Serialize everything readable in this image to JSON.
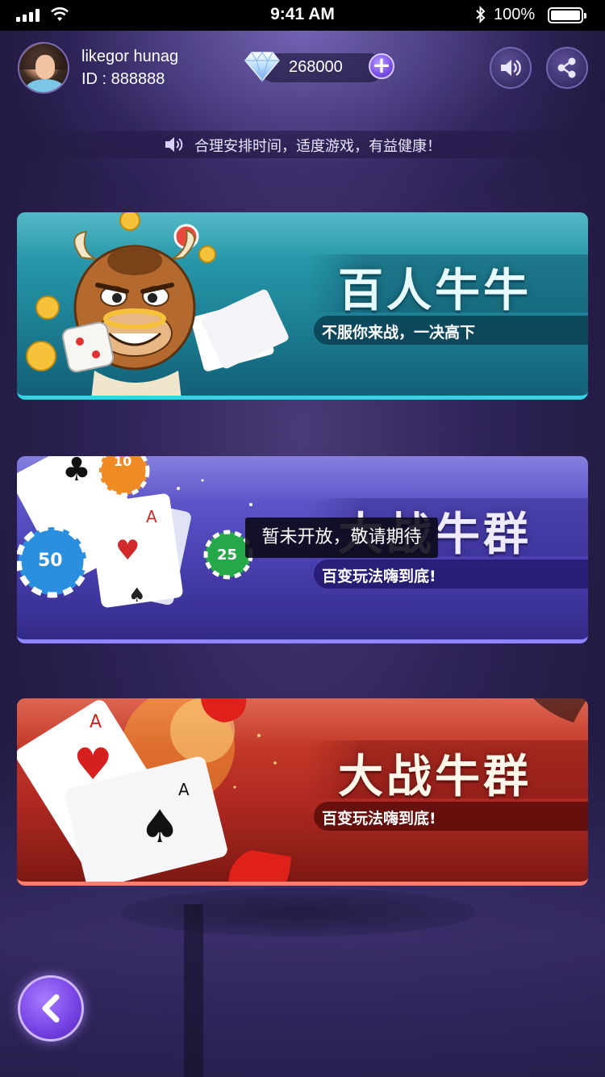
{
  "status_bar": {
    "time": "9:41 AM",
    "battery_text": "100%",
    "battery_level": 1.0,
    "icons": [
      "signal-icon",
      "wifi-icon",
      "bluetooth-icon",
      "battery-icon"
    ]
  },
  "user": {
    "name": "likegor hunag",
    "id_text": "ID : 888888"
  },
  "currency": {
    "icon": "diamond-icon",
    "amount": "268000",
    "add_icon": "plus-icon"
  },
  "header_buttons": {
    "sound_icon": "speaker-icon",
    "share_icon": "share-icon"
  },
  "notice": {
    "icon": "speaker-icon",
    "text": "合理安排时间，适度游戏，有益健康！"
  },
  "games": [
    {
      "title": "百人牛牛",
      "subtitle": "不服你来战，一决高下",
      "theme": "#1e8397"
    },
    {
      "title": "大战牛群",
      "subtitle": "百变玩法嗨到底!",
      "theme": "#4b41b3"
    },
    {
      "title": "大战牛群",
      "subtitle": "百变玩法嗨到底!",
      "theme": "#b02a22"
    }
  ],
  "toast": {
    "text": "暂未开放，敬请期待"
  },
  "back_button": {
    "icon": "chevron-left-icon"
  },
  "colors": {
    "background": "#2d2255",
    "accent": "#7a45e6"
  }
}
